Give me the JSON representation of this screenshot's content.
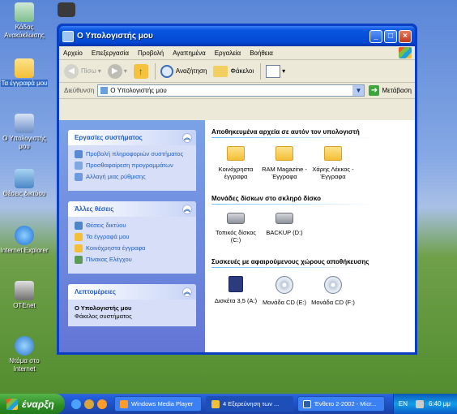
{
  "desktop": {
    "icons": [
      {
        "label": "Κάδος Ανακύκλωσης"
      },
      {
        "label": "Τα έγγραφά μου"
      },
      {
        "label": "Ο Υπολογιστής μου"
      },
      {
        "label": "Θέσεις δικτύου"
      },
      {
        "label": "Internet Explorer"
      },
      {
        "label": "OTEnet"
      },
      {
        "label": "Ντάμα στο Internet"
      }
    ]
  },
  "window": {
    "title": "Ο Υπολογιστής μου",
    "menu": [
      "Αρχείο",
      "Επεξεργασία",
      "Προβολή",
      "Αγαπημένα",
      "Εργαλεία",
      "Βοήθεια"
    ],
    "toolbar": {
      "back_label": "Πίσω",
      "search_label": "Αναζήτηση",
      "folders_label": "Φάκελοι"
    },
    "address": {
      "label": "Διεύθυνση",
      "value": "Ο Υπολογιστής μου",
      "go_label": "Μετάβαση"
    },
    "left": {
      "system_tasks": {
        "title": "Εργασίες συστήματος",
        "items": [
          {
            "label": "Προβολή πληροφοριών συστήματος",
            "icon": "info-icon"
          },
          {
            "label": "Προσθαφαίρεση προγραμμάτων",
            "icon": "programs-icon"
          },
          {
            "label": "Αλλαγή μιας ρύθμισης",
            "icon": "control-icon"
          }
        ]
      },
      "other_places": {
        "title": "Άλλες θέσεις",
        "items": [
          {
            "label": "Θέσεις δικτύου",
            "icon": "network-icon"
          },
          {
            "label": "Τα έγγραφά μου",
            "icon": "documents-icon"
          },
          {
            "label": "Κοινόχρηστα έγγραφα",
            "icon": "shared-folder-icon"
          },
          {
            "label": "Πίνακας Ελέγχου",
            "icon": "control-panel-icon"
          }
        ]
      },
      "details": {
        "title": "Λεπτομέρειες",
        "name": "Ο Υπολογιστής μου",
        "type": "Φάκελος συστήματος"
      }
    },
    "right": {
      "groups": [
        {
          "title": "Αποθηκευμένα αρχεία σε αυτόν τον υπολογιστή",
          "items": [
            {
              "label": "Κοινόχρηστα έγγραφα",
              "kind": "folder"
            },
            {
              "label": "RAM Magazine - Έγγραφα",
              "kind": "folder"
            },
            {
              "label": "Χάρης Λέκκος - Έγγραφα",
              "kind": "folder"
            }
          ]
        },
        {
          "title": "Μονάδες δίσκων στο σκληρό δίσκο",
          "items": [
            {
              "label": "Τοπικός δίσκος (C:)",
              "kind": "drive"
            },
            {
              "label": "BACKUP (D:)",
              "kind": "drive"
            }
          ]
        },
        {
          "title": "Συσκευές με αφαιρούμενους χώρους αποθήκευσης",
          "items": [
            {
              "label": "Δισκέτα 3,5 (A:)",
              "kind": "floppy"
            },
            {
              "label": "Μονάδα CD (E:)",
              "kind": "cd"
            },
            {
              "label": "Μονάδα CD (F:)",
              "kind": "cd"
            }
          ]
        }
      ]
    }
  },
  "taskbar": {
    "start_label": "έναρξη",
    "tasks": [
      {
        "label": "Windows Media Player"
      },
      {
        "label": "4 Εξερεύνηση των ..."
      },
      {
        "label": "Ένθετο 2-2002 - Micr..."
      }
    ],
    "language": "EN",
    "clock": "6:40 μμ"
  }
}
